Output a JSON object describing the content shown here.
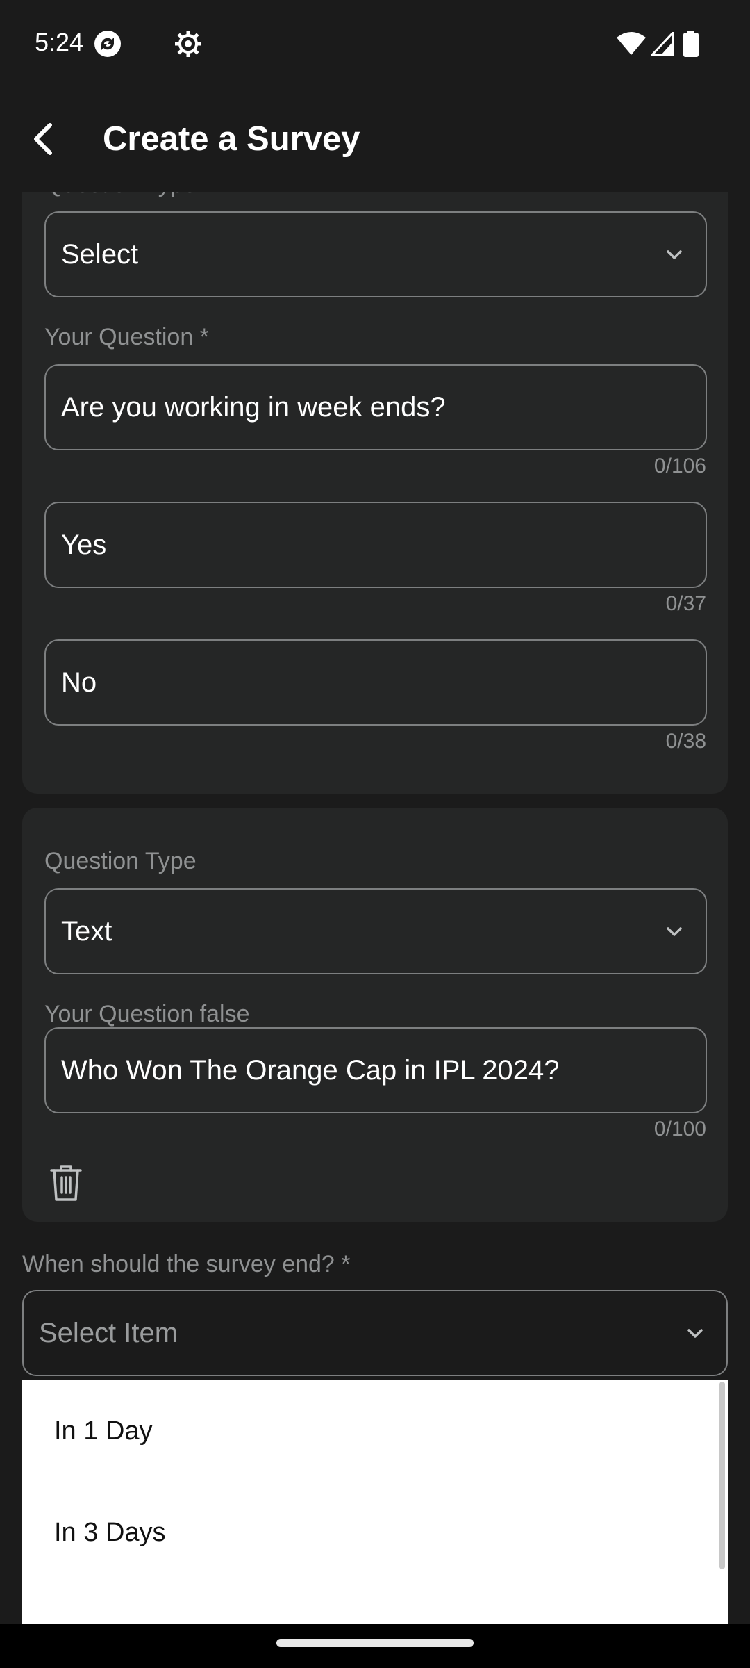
{
  "status_bar": {
    "time": "5:24",
    "icons": [
      "sync-icon",
      "settings-gear-icon",
      "wifi-icon",
      "signal-icon",
      "battery-icon"
    ]
  },
  "app_bar": {
    "title": "Create a Survey",
    "back_icon": "arrow-back-icon"
  },
  "question1": {
    "type_label": "Question Type",
    "type_value": "Select",
    "question_label": "Your Question *",
    "question_value": "Are you working in week ends?",
    "question_counter": "0/106",
    "options": [
      {
        "value": "Yes",
        "counter": "0/37"
      },
      {
        "value": "No",
        "counter": "0/38"
      }
    ]
  },
  "question2": {
    "type_label": "Question Type",
    "type_value": "Text",
    "question_label": "Your Question false",
    "question_value": "Who Won The Orange Cap in IPL 2024?",
    "question_counter": "0/100",
    "delete_icon": "trash-icon"
  },
  "survey_end": {
    "label": "When should the survey end? *",
    "placeholder": "Select Item"
  },
  "dropdown_menu": {
    "items": [
      "In 1 Day",
      "In 3 Days"
    ]
  },
  "colors": {
    "background": "#1b1b1b",
    "card": "#252626",
    "outline": "#7d7f80",
    "muted_text": "#8f9192",
    "menu_background": "#ffffff"
  }
}
